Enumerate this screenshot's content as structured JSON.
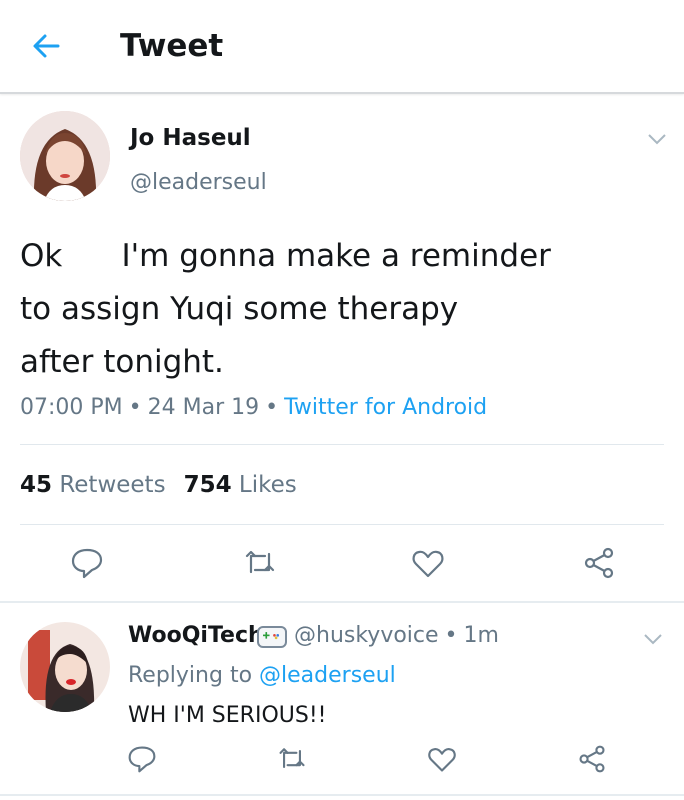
{
  "header": {
    "title": "Tweet",
    "back_icon": "arrow-left-icon",
    "accent": "#1da1f2"
  },
  "tweet": {
    "author": {
      "name": "Jo Haseul",
      "handle": "@leaderseul"
    },
    "text_lines": [
      "Ok      I'm gonna make a reminder",
      "to assign Yuqi some therapy",
      "after tonight."
    ],
    "time": "07:00 PM",
    "separator": "•",
    "date": "24 Mar 19",
    "source": "Twitter for Android",
    "retweets_count": "45",
    "retweets_label": "Retweets",
    "likes_count": "754",
    "likes_label": "Likes"
  },
  "reply": {
    "author": {
      "name": "WooQiTech",
      "handle": "@huskyvoice"
    },
    "time": "1m",
    "replying_prefix": "Replying to",
    "replying_to": "@leaderseul",
    "text": "WH I'M SERIOUS!!"
  },
  "actions": [
    "reply-icon",
    "retweet-icon",
    "like-icon",
    "share-icon"
  ],
  "colors": {
    "text": "#14171a",
    "muted": "#657786",
    "link": "#1da1f2",
    "divider": "#e1e8ed"
  }
}
